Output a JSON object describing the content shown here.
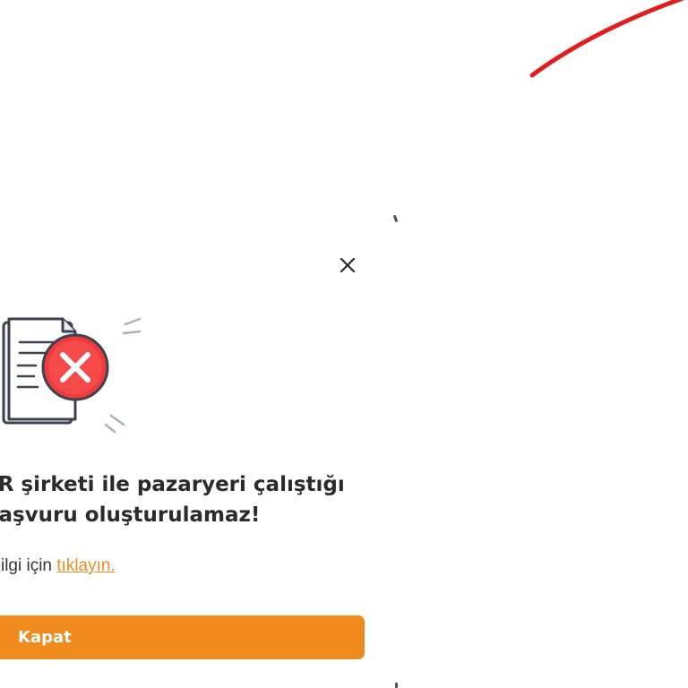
{
  "modal": {
    "message_line1": "TR şirketi ile pazaryeri çalıştığı",
    "message_line2": "başvuru oluşturulamaz!",
    "info_prefix": "ha bilgi için",
    "info_link": "tıklayın.",
    "close_button_label": "Kapat",
    "close_icon": "close-icon",
    "illustration_icon": "document-error-icon"
  },
  "colors": {
    "accent": "#f08a1c",
    "error": "#ef3b3b",
    "decorative_arc": "#e11d1d",
    "text": "#2b2b2b"
  }
}
